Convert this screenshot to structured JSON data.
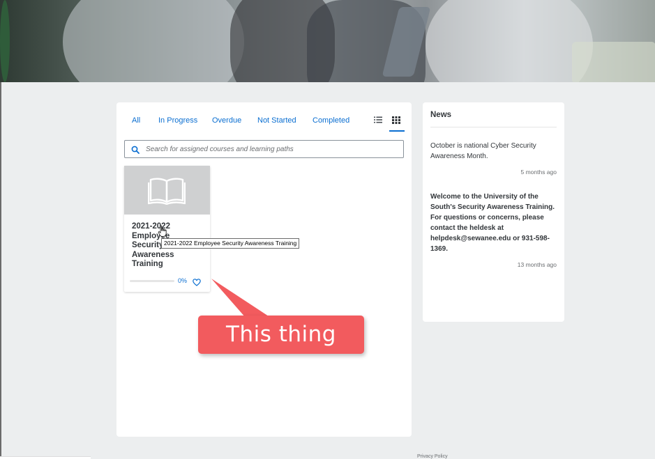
{
  "tabs": [
    {
      "label": "All"
    },
    {
      "label": "In Progress"
    },
    {
      "label": "Overdue"
    },
    {
      "label": "Not Started"
    },
    {
      "label": "Completed"
    }
  ],
  "view_toggle": {
    "active": "grid",
    "list_icon": "list-icon",
    "grid_icon": "grid-icon"
  },
  "search": {
    "placeholder": "Search for assigned courses and learning paths",
    "value": ""
  },
  "courses": [
    {
      "title": "2021-2022 Employee Security Awareness Training",
      "progress_label": "0%",
      "progress": 0,
      "thumbnail_icon": "book-icon",
      "favorite_icon": "heart-icon"
    }
  ],
  "tooltip": {
    "text": "2021-2022 Employee Security Awareness Training"
  },
  "news": {
    "title": "News",
    "items": [
      {
        "text": "October is national Cyber Security Awareness Month.",
        "time": "5 months ago",
        "bold": false
      },
      {
        "text": "Welcome to the University of the South's Security Awareness Training. For questions or concerns, please contact the heldesk at helpdesk@sewanee.edu or 931-598-1369.",
        "time": "13 months ago",
        "bold": true
      }
    ]
  },
  "annotation": {
    "text": "This thing",
    "color": "#f25b5e"
  },
  "footer": {
    "privacy": "Privacy Policy"
  },
  "colors": {
    "accent": "#0a6ed1",
    "panel": "#ffffff",
    "background": "#eceeef"
  }
}
